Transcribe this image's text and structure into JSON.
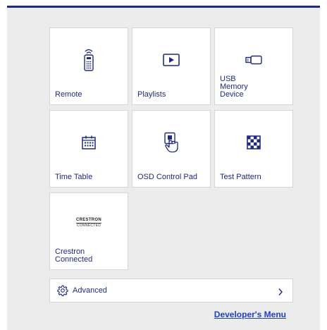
{
  "tiles": [
    {
      "label": "Remote",
      "icon": "remote-control-icon"
    },
    {
      "label": "Playlists",
      "icon": "play-icon"
    },
    {
      "label": "USB Memory Device",
      "icon": "usb-stick-icon"
    },
    {
      "label": "Time Table",
      "icon": "calendar-icon"
    },
    {
      "label": "OSD Control Pad",
      "icon": "touch-pad-icon"
    },
    {
      "label": "Test Pattern",
      "icon": "checkerboard-icon"
    },
    {
      "label": "Crestron Connected",
      "icon": "crestron-logo",
      "logo_top": "CRESTRON",
      "logo_bottom": "CONNECTED"
    }
  ],
  "advanced": {
    "label": "Advanced",
    "icon": "gear-icon",
    "chevron": "chevron-right-icon"
  },
  "developer_link": "Developer's Menu",
  "colors": {
    "accent": "#1f2a7c",
    "link": "#1f3fc8",
    "background": "#ececec"
  }
}
